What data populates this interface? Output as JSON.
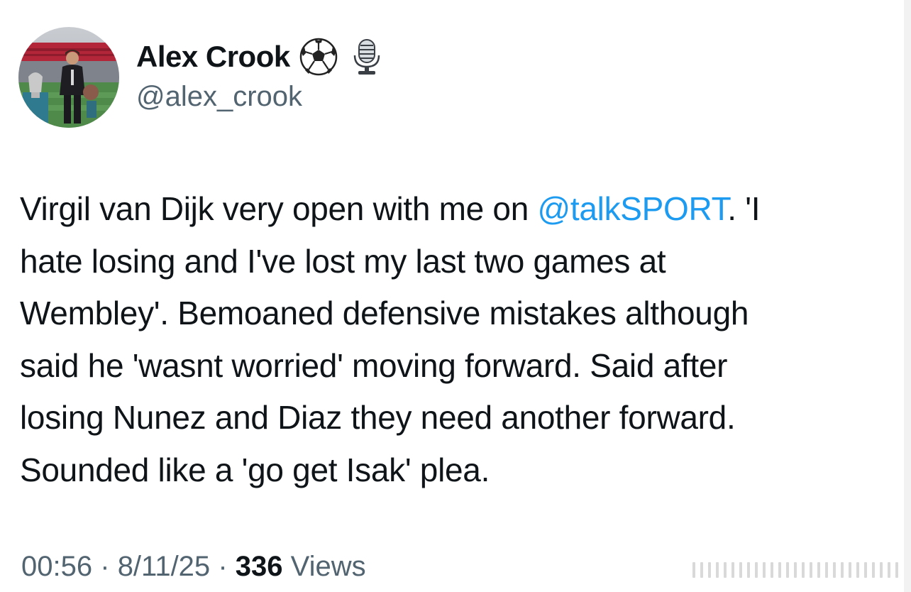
{
  "author": {
    "display_name": "Alex Crook",
    "handle": "@alex_crook",
    "badges": [
      "soccer-ball-icon",
      "microphone-icon"
    ]
  },
  "tweet": {
    "lines": [
      {
        "pre": "Virgil van Dijk very open with me on ",
        "mention": "@talkSPORT",
        "post": ". 'I"
      },
      {
        "text": "hate losing and I've lost my last two games at"
      },
      {
        "text": "Wembley'. Bemoaned defensive mistakes although"
      },
      {
        "text": "said he 'wasnt worried' moving forward. Said after"
      },
      {
        "text": "losing Nunez and Diaz they need another forward."
      },
      {
        "text": "Sounded like a 'go get Isak' plea."
      }
    ]
  },
  "meta": {
    "time": "00:56",
    "separator": "·",
    "date": "8/11/25",
    "views_count": "336",
    "views_label": "Views"
  },
  "colors": {
    "text": "#0f1419",
    "secondary": "#536471",
    "link": "#1d9bf0"
  }
}
